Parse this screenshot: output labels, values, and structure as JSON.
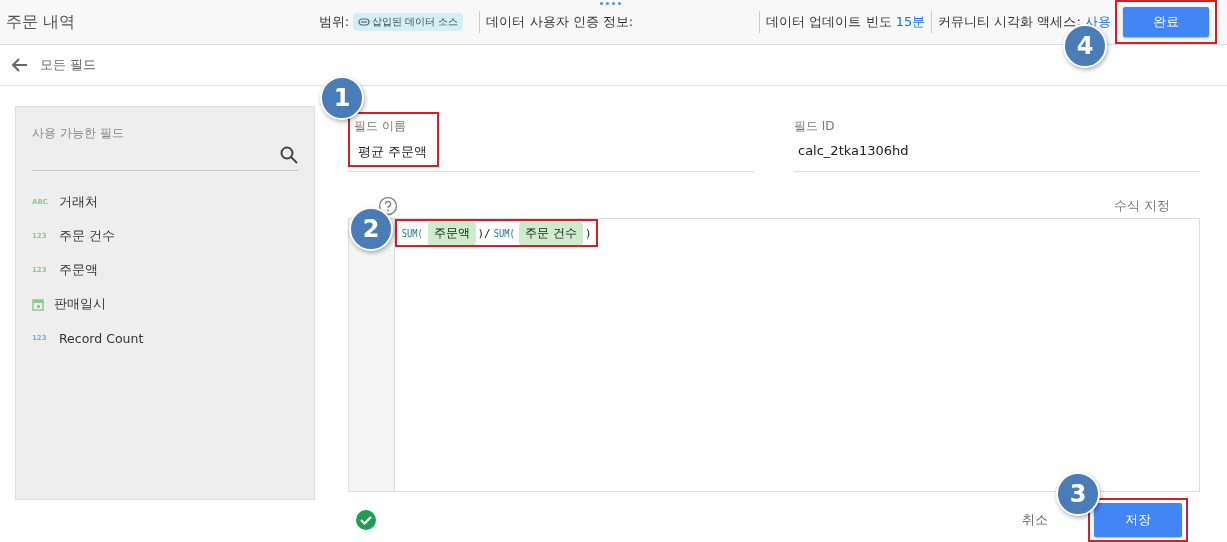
{
  "header": {
    "title": "주문 내역",
    "scope_label": "범위:",
    "scope_chip": "삽입된 데이터 소스",
    "credentials": "데이터 사용자 인증 정보:",
    "freshness_label": "데이터 업데이트 빈도",
    "freshness_value": "15분",
    "community_label": "커뮤니티 시각화 액세스:",
    "community_value": "사용",
    "done_button": {
      "label": "완료",
      "highlighted": true,
      "callout": "4"
    }
  },
  "nav": {
    "back_label": "모든 필드"
  },
  "sidebar": {
    "title": "사용 가능한 필드",
    "fields": [
      {
        "kind": "text",
        "type_label": "ABC",
        "name": "거래처",
        "color": "#8fc98f"
      },
      {
        "kind": "number",
        "type_label": "123",
        "name": "주문 건수",
        "color": "#8fc98f"
      },
      {
        "kind": "number",
        "type_label": "123",
        "name": "주문액",
        "color": "#8fc98f"
      },
      {
        "kind": "date",
        "name": "판매일시",
        "color": "#8fc98f"
      },
      {
        "kind": "number",
        "type_label": "123",
        "name": "Record Count",
        "color": "#7baaf7"
      }
    ]
  },
  "field_name": {
    "label": "필드 이름",
    "value": "평균 주문액",
    "highlighted": true,
    "callout": "1"
  },
  "field_id": {
    "label": "필드 ID",
    "value": "calc_2tka1306hd"
  },
  "formula": {
    "format_label": "수식 지정",
    "highlighted": true,
    "callout": "2",
    "valid": true,
    "tokens": [
      {
        "kind": "function",
        "text": "SUM("
      },
      {
        "kind": "field",
        "text": "주문액"
      },
      {
        "kind": "plain",
        "text": ")/"
      },
      {
        "kind": "function",
        "text": "SUM("
      },
      {
        "kind": "field",
        "text": "주문 건수"
      },
      {
        "kind": "plain",
        "text": ")"
      }
    ]
  },
  "actions": {
    "cancel": "취소",
    "save": {
      "label": "저장",
      "highlighted": true,
      "callout": "3"
    }
  }
}
